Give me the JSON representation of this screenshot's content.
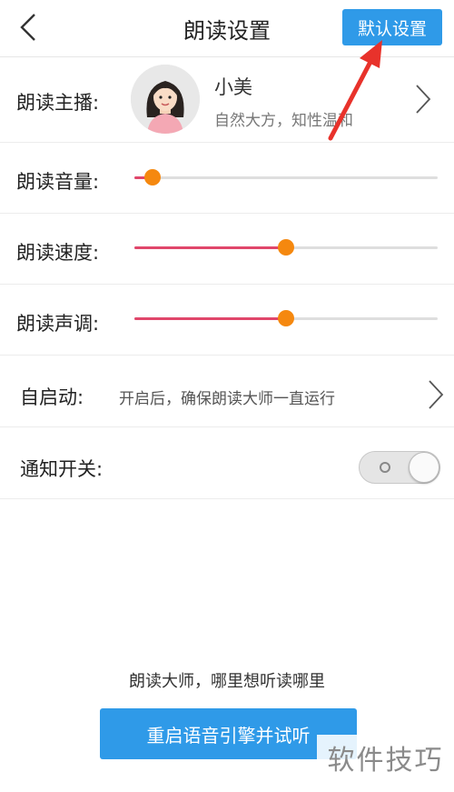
{
  "header": {
    "title": "朗读设置",
    "default_button": "默认设置"
  },
  "anchor": {
    "label": "朗读主播:",
    "name": "小美",
    "description": "自然大方，知性温和"
  },
  "volume": {
    "label": "朗读音量:",
    "level": 0.06
  },
  "speed": {
    "label": "朗读速度:",
    "level": 0.5
  },
  "pitch": {
    "label": "朗读声调:",
    "level": 0.5
  },
  "autostart": {
    "label": "自启动:",
    "description": "开启后，确保朗读大师一直运行"
  },
  "notification": {
    "label": "通知开关:",
    "state": "off"
  },
  "footer": {
    "slogan": "朗读大师，哪里想听读哪里",
    "restart_button": "重启语音引擎并试听"
  },
  "watermark": "软件技巧",
  "colors": {
    "accent_blue": "#2f9ae8",
    "slider_fill": "#e0476b",
    "slider_thumb": "#f5880f",
    "annotation_arrow": "#e8322b"
  },
  "icons": {
    "back": "chevron-left-icon",
    "row_arrow": "chevron-right-icon"
  }
}
